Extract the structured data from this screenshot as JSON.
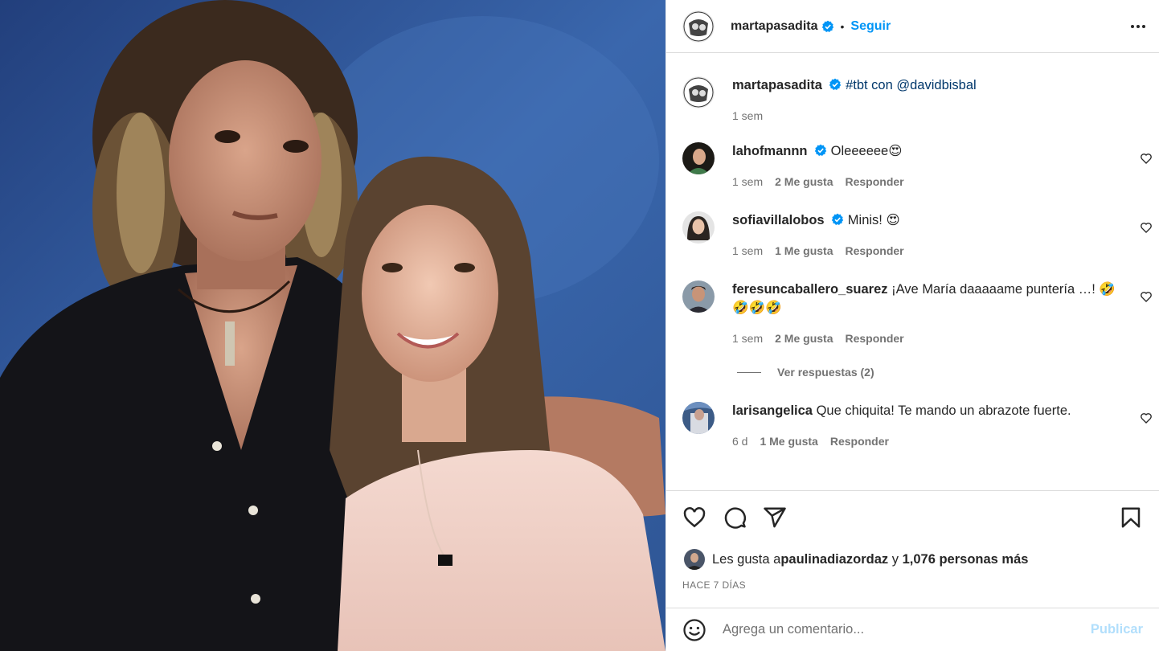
{
  "post": {
    "author": "martapasadita",
    "follow_label": "Seguir",
    "separator": "•",
    "caption_text": " #tbt con ",
    "caption_mention": "@davidbisbal",
    "caption_time": "1 sem"
  },
  "comments": [
    {
      "user": "lahofmannn",
      "verified": true,
      "text": " Oleeeeee😍",
      "time": "1 sem",
      "likes": "2 Me gusta",
      "reply": "Responder"
    },
    {
      "user": "sofiavillalobos",
      "verified": true,
      "text": " Minis! 😍",
      "time": "1 sem",
      "likes": "1 Me gusta",
      "reply": "Responder"
    },
    {
      "user": "feresuncaballero_suarez",
      "verified": false,
      "text": " ¡Ave María daaaaame puntería …! 🤣🤣🤣🤣",
      "time": "1 sem",
      "likes": "2 Me gusta",
      "reply": "Responder",
      "view_replies": "Ver respuestas (2)"
    },
    {
      "user": "larisangelica",
      "verified": false,
      "text": " Que chiquita! Te mando un abrazote fuerte.",
      "time": "6 d",
      "likes": "1 Me gusta",
      "reply": "Responder"
    }
  ],
  "likes_summary": {
    "prefix": "Les gusta a ",
    "user": "paulinadiazordaz",
    "middle": " y ",
    "others": "1,076 personas más"
  },
  "post_date": "HACE 7 DÍAS",
  "add_comment": {
    "placeholder": "Agrega un comentario...",
    "publish_label": "Publicar"
  },
  "icons": {
    "verified": "verified-badge-icon",
    "more": "more-options-icon",
    "like": "heart-icon",
    "comment": "comment-bubble-icon",
    "share": "paper-plane-icon",
    "save": "bookmark-icon",
    "emoji": "emoji-smiley-icon"
  },
  "colors": {
    "accent": "#0095f6",
    "publish_disabled": "#b2dffc",
    "secondary_text": "#737373",
    "verified": "#0095f6"
  }
}
